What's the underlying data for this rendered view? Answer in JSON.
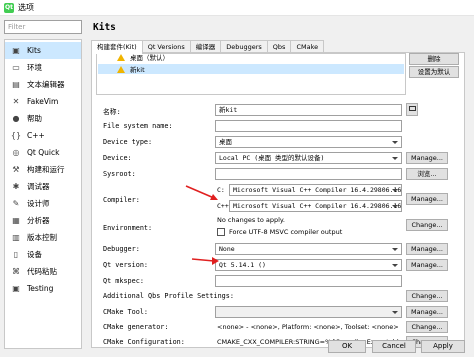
{
  "window": {
    "title": "选项",
    "app_icon": "qt-creator-icon"
  },
  "filter": {
    "placeholder": "Filter"
  },
  "nav": [
    {
      "label": "Kits",
      "icon": "kits-icon",
      "selected": true
    },
    {
      "label": "环境",
      "icon": "environment-icon"
    },
    {
      "label": "文本编辑器",
      "icon": "text-editor-icon"
    },
    {
      "label": "FakeVim",
      "icon": "fakevim-icon"
    },
    {
      "label": "帮助",
      "icon": "help-icon"
    },
    {
      "label": "C++",
      "icon": "cpp-icon"
    },
    {
      "label": "Qt Quick",
      "icon": "qt-quick-icon"
    },
    {
      "label": "构建和运行",
      "icon": "build-run-icon"
    },
    {
      "label": "调试器",
      "icon": "debugger-icon"
    },
    {
      "label": "设计师",
      "icon": "designer-icon"
    },
    {
      "label": "分析器",
      "icon": "analyzer-icon"
    },
    {
      "label": "版本控制",
      "icon": "version-control-icon"
    },
    {
      "label": "设备",
      "icon": "devices-icon"
    },
    {
      "label": "代码粘贴",
      "icon": "code-paste-icon"
    },
    {
      "label": "Testing",
      "icon": "testing-icon"
    }
  ],
  "page_title": "Kits",
  "tabs": [
    "构建套件(Kit)",
    "Qt Versions",
    "编译器",
    "Debuggers",
    "Qbs",
    "CMake"
  ],
  "kit_list": {
    "partial_item": "桌面（默认）",
    "selected_item": "新kit"
  },
  "kit_buttons": {
    "remove": "删除",
    "make_default": "设置为默认"
  },
  "form": {
    "name": {
      "label": "名称:",
      "value": "新kit"
    },
    "filesystem": {
      "label": "File system name:",
      "value": ""
    },
    "device_type": {
      "label": "Device type:",
      "value": "桌面"
    },
    "device": {
      "label": "Device:",
      "value": "Local PC (桌面 类型的默认设备)",
      "button": "Manage..."
    },
    "sysroot": {
      "label": "Sysroot:",
      "value": "",
      "button": "浏览..."
    },
    "compiler": {
      "label": "Compiler:",
      "c_label": "C:",
      "c_value": "Microsoft Visual C++ Compiler 16.4.29806.167",
      "cpp_label": "C++:",
      "cpp_value": "Microsoft Visual C++ Compiler 16.4.29806.167",
      "button": "Manage..."
    },
    "environment": {
      "label": "Environment:",
      "note": "No changes to apply.",
      "checkbox_label": "Force UTF-8 MSVC compiler output",
      "button": "Change..."
    },
    "debugger": {
      "label": "Debugger:",
      "value": "None",
      "button": "Manage..."
    },
    "qt_version": {
      "label": "Qt version:",
      "value": "Qt 5.14.1 ()",
      "button": "Manage..."
    },
    "qt_mkspec": {
      "label": "Qt mkspec:",
      "value": ""
    },
    "qbs": {
      "label": "Additional Qbs Profile Settings:",
      "button": "Change..."
    },
    "cmake_tool": {
      "label": "CMake Tool:",
      "value": "",
      "button": "Manage..."
    },
    "cmake_generator": {
      "label": "CMake generator:",
      "value": "<none> - <none>, Platform: <none>, Toolset: <none>",
      "button": "Change..."
    },
    "cmake_config": {
      "label": "CMake Configuration:",
      "value": "CMAKE_CXX_COMPILER:STRING=%{Compiler:Executable:Cxx}",
      "button": "Change..."
    }
  },
  "footer": {
    "ok": "OK",
    "cancel": "Cancel",
    "apply": "Apply"
  },
  "colors": {
    "selection": "#cce8ff",
    "arrow": "#e02020",
    "warning": "#f0b400"
  }
}
